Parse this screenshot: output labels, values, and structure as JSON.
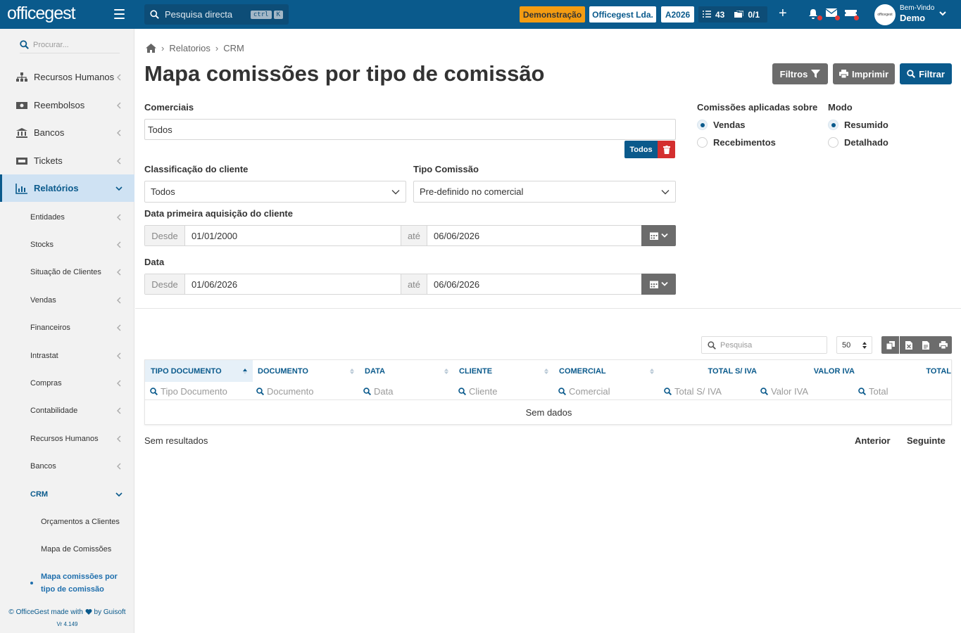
{
  "topbar": {
    "logo": "officegest",
    "search_label": "Pesquisa directa",
    "kbd_ctrl": "ctrl",
    "kbd_key": "K",
    "demo": "Demonstração",
    "company": "Officegest Lda.",
    "year": "A2026",
    "tasks_count": "43",
    "docs_count": "0/1",
    "avatar_text": "officegest",
    "welcome": "Bem-Vindo",
    "user": "Demo"
  },
  "sidebar": {
    "search_placeholder": "Procurar...",
    "items": [
      {
        "label": "Recursos Humanos"
      },
      {
        "label": "Reembolsos"
      },
      {
        "label": "Bancos"
      },
      {
        "label": "Tickets"
      },
      {
        "label": "Relatórios"
      }
    ],
    "sub_items": [
      {
        "label": "Entidades"
      },
      {
        "label": "Stocks"
      },
      {
        "label": "Situação de Clientes"
      },
      {
        "label": "Vendas"
      },
      {
        "label": "Financeiros"
      },
      {
        "label": "Intrastat"
      },
      {
        "label": "Compras"
      },
      {
        "label": "Contabilidade"
      },
      {
        "label": "Recursos Humanos"
      },
      {
        "label": "Bancos"
      },
      {
        "label": "CRM"
      }
    ],
    "crm_items": [
      {
        "label": "Orçamentos a Clientes"
      },
      {
        "label": "Mapa de Comissões"
      }
    ],
    "current": "Mapa comissões por tipo de comissão",
    "footer_left": "© OfficeGest made with",
    "footer_right": "by Guisoft",
    "version": "Vr 4.149"
  },
  "breadcrumb": {
    "items": [
      "Relatorios",
      "CRM"
    ]
  },
  "page": {
    "title": "Mapa comissões por tipo de comissão",
    "btn_filtros": "Filtros",
    "btn_imprimir": "Imprimir",
    "btn_filtrar": "Filtrar"
  },
  "form": {
    "comerciais_label": "Comerciais",
    "comerciais_value": "Todos",
    "todos_btn": "Todos",
    "class_label": "Classificação do cliente",
    "class_value": "Todos",
    "tipo_label": "Tipo Comissão",
    "tipo_value": "Pre-definido no comercial",
    "aquisicao_label": "Data primeira aquisição do cliente",
    "aq_desde": "Desde",
    "aq_from": "01/01/2000",
    "aq_ate": "até",
    "aq_to": "06/06/2026",
    "data_label": "Data",
    "d_desde": "Desde",
    "d_from": "01/06/2026",
    "d_ate": "até",
    "d_to": "06/06/2026",
    "aplicadas_label": "Comissões aplicadas sobre",
    "opt_vendas": "Vendas",
    "opt_recebimentos": "Recebimentos",
    "modo_label": "Modo",
    "opt_resumido": "Resumido",
    "opt_detalhado": "Detalhado"
  },
  "table": {
    "search_placeholder": "Pesquisa",
    "page_size": "50",
    "columns": [
      "TIPO DOCUMENTO",
      "DOCUMENTO",
      "DATA",
      "CLIENTE",
      "COMERCIAL",
      "TOTAL S/ IVA",
      "VALOR IVA",
      "TOTAL"
    ],
    "filters": [
      "Tipo Documento",
      "Documento",
      "Data",
      "Cliente",
      "Comercial",
      "Total S/ IVA",
      "Valor IVA",
      "Total"
    ],
    "empty": "Sem dados",
    "results": "Sem resultados",
    "prev": "Anterior",
    "next": "Seguinte"
  },
  "colors": {
    "brand": "#0a5a8c",
    "demo": "#f39c12",
    "danger": "#d42f2f",
    "gray_btn": "#6c6c6c"
  }
}
